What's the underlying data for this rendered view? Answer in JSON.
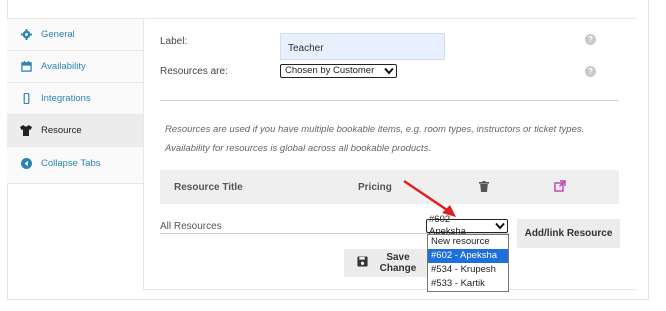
{
  "sidebar": {
    "items": [
      {
        "label": "General",
        "icon": "gear-icon"
      },
      {
        "label": "Availability",
        "icon": "calendar-icon"
      },
      {
        "label": "Integrations",
        "icon": "mobile-icon"
      },
      {
        "label": "Resource",
        "icon": "shirt-icon"
      },
      {
        "label": "Collapse Tabs",
        "icon": "collapse-icon"
      }
    ],
    "active": "Resource"
  },
  "form": {
    "label_label": "Label:",
    "label_value": "Teacher",
    "resources_are_label": "Resources are:",
    "resources_are_value": "Chosen by Customer",
    "help_glyph": "?"
  },
  "note": "Resources are used if you have multiple bookable items, e.g. room types, instructors or ticket types. Availability for resources is global across all bookable products.",
  "table": {
    "col_title": "Resource Title",
    "col_pricing": "Pricing"
  },
  "all_resources": {
    "label": "All Resources",
    "select_value": "#602 - Apeksha",
    "options": [
      "New resource",
      "#602 - Apeksha",
      "#534 - Krupesh",
      "#533 - Kartik"
    ],
    "selected_index": 1
  },
  "buttons": {
    "add_link": "Add/link Resource",
    "save": "Save Change"
  },
  "colors": {
    "accent": "#2a83b5",
    "link_icon": "#c03fb8",
    "arrow": "#e02020",
    "selected_option": "#1e6fd9"
  }
}
